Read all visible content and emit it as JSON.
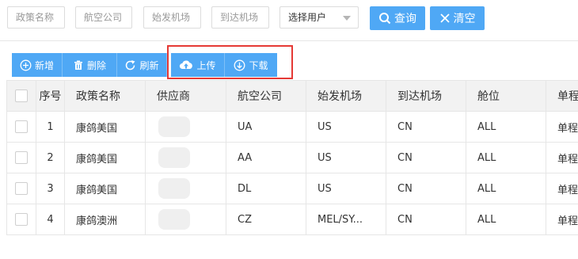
{
  "filters": {
    "policy_name_placeholder": "政策名称",
    "airline_placeholder": "航空公司",
    "origin_placeholder": "始发机场",
    "destination_placeholder": "到达机场",
    "user_select_value": "选择用户"
  },
  "actions": {
    "search_label": "查询",
    "clear_label": "清空"
  },
  "toolbar": {
    "add_label": "新增",
    "delete_label": "删除",
    "refresh_label": "刷新",
    "upload_label": "上传",
    "download_label": "下载"
  },
  "table": {
    "columns": [
      "序号",
      "政策名称",
      "供应商",
      "航空公司",
      "始发机场",
      "到达机场",
      "舱位",
      "单程"
    ],
    "rows": [
      {
        "index": "1",
        "policy_name": "康鸽美国",
        "airline": "UA",
        "origin": "US",
        "destination": "CN",
        "cabin": "ALL",
        "trip": "单程"
      },
      {
        "index": "2",
        "policy_name": "康鸽美国",
        "airline": "AA",
        "origin": "US",
        "destination": "CN",
        "cabin": "ALL",
        "trip": "单程"
      },
      {
        "index": "3",
        "policy_name": "康鸽美国",
        "airline": "DL",
        "origin": "US",
        "destination": "CN",
        "cabin": "ALL",
        "trip": "单程"
      },
      {
        "index": "4",
        "policy_name": "康鸽澳洲",
        "airline": "CZ",
        "origin": "MEL/SY...",
        "destination": "CN",
        "cabin": "ALL",
        "trip": "单程"
      }
    ]
  },
  "colors": {
    "primary": "#4fa8f5",
    "highlight": "#e53935",
    "header_bg": "#f2f2f2"
  }
}
